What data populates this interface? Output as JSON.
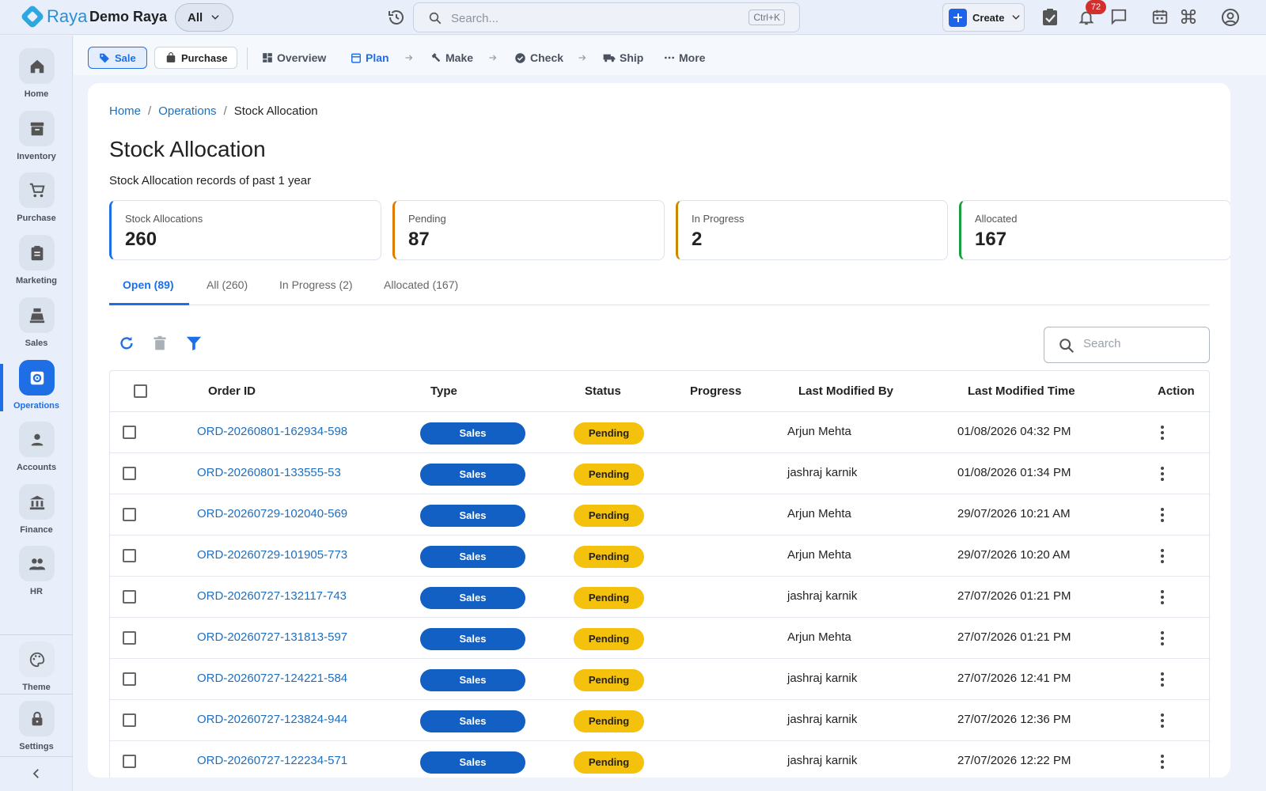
{
  "topbar": {
    "brand": "Raya",
    "company": "Demo Raya",
    "scope": "All",
    "search_placeholder": "Search...",
    "search_shortcut": "Ctrl+K",
    "create_label": "Create",
    "notification_count": "72",
    "icons": [
      "history-icon",
      "search-icon",
      "tasks-icon",
      "bell-icon",
      "chat-icon",
      "calendar-icon",
      "command-icon",
      "account-icon"
    ]
  },
  "sidebar": {
    "items": [
      {
        "label": "Home",
        "icon": "home-icon"
      },
      {
        "label": "Inventory",
        "icon": "archive-icon"
      },
      {
        "label": "Purchase",
        "icon": "cart-icon"
      },
      {
        "label": "Marketing",
        "icon": "clipboard-icon"
      },
      {
        "label": "Sales",
        "icon": "register-icon"
      },
      {
        "label": "Operations",
        "icon": "gear-box-icon",
        "active": true
      },
      {
        "label": "Accounts",
        "icon": "person-icon"
      },
      {
        "label": "Finance",
        "icon": "bank-icon"
      },
      {
        "label": "HR",
        "icon": "people-icon"
      }
    ],
    "theme_label": "Theme",
    "settings_label": "Settings"
  },
  "subnav": {
    "chips": [
      {
        "label": "Sale",
        "active": true
      },
      {
        "label": "Purchase",
        "active": false
      }
    ],
    "items": [
      {
        "label": "Overview",
        "icon": "dashboard-icon"
      },
      {
        "label": "Plan",
        "icon": "calendar-icon",
        "active": true
      },
      {
        "label": "Make",
        "icon": "hammer-icon"
      },
      {
        "label": "Check",
        "icon": "verified-icon"
      },
      {
        "label": "Ship",
        "icon": "truck-icon"
      },
      {
        "label": "More",
        "icon": "dots-icon"
      }
    ]
  },
  "breadcrumb": {
    "home": "Home",
    "section": "Operations",
    "current": "Stock Allocation"
  },
  "page": {
    "title": "Stock Allocation",
    "subtitle": "Stock Allocation records of past 1 year"
  },
  "kpis": [
    {
      "label": "Stock Allocations",
      "value": "260",
      "color": "#1e6fe6"
    },
    {
      "label": "Pending",
      "value": "87",
      "color": "#e07b00"
    },
    {
      "label": "In Progress",
      "value": "2",
      "color": "#c98a00"
    },
    {
      "label": "Allocated",
      "value": "167",
      "color": "#1a9e3f"
    }
  ],
  "tabs": [
    {
      "label": "Open (89)",
      "active": true
    },
    {
      "label": "All (260)"
    },
    {
      "label": "In Progress (2)"
    },
    {
      "label": "Allocated (167)"
    }
  ],
  "grid_search_placeholder": "Search",
  "table": {
    "columns": [
      "Order ID",
      "Type",
      "Status",
      "Progress",
      "Last Modified By",
      "Last Modified Time",
      "Action"
    ],
    "rows": [
      {
        "id": "ORD-20260801-162934-598",
        "type": "Sales",
        "status": "Pending",
        "progress": "",
        "by": "Arjun Mehta",
        "time": "01/08/2026 04:32 PM"
      },
      {
        "id": "ORD-20260801-133555-53",
        "type": "Sales",
        "status": "Pending",
        "progress": "",
        "by": "jashraj karnik",
        "time": "01/08/2026 01:34 PM"
      },
      {
        "id": "ORD-20260729-102040-569",
        "type": "Sales",
        "status": "Pending",
        "progress": "",
        "by": "Arjun Mehta",
        "time": "29/07/2026 10:21 AM"
      },
      {
        "id": "ORD-20260729-101905-773",
        "type": "Sales",
        "status": "Pending",
        "progress": "",
        "by": "Arjun Mehta",
        "time": "29/07/2026 10:20 AM"
      },
      {
        "id": "ORD-20260727-132117-743",
        "type": "Sales",
        "status": "Pending",
        "progress": "",
        "by": "jashraj karnik",
        "time": "27/07/2026 01:21 PM"
      },
      {
        "id": "ORD-20260727-131813-597",
        "type": "Sales",
        "status": "Pending",
        "progress": "",
        "by": "Arjun Mehta",
        "time": "27/07/2026 01:21 PM"
      },
      {
        "id": "ORD-20260727-124221-584",
        "type": "Sales",
        "status": "Pending",
        "progress": "",
        "by": "jashraj karnik",
        "time": "27/07/2026 12:41 PM"
      },
      {
        "id": "ORD-20260727-123824-944",
        "type": "Sales",
        "status": "Pending",
        "progress": "",
        "by": "jashraj karnik",
        "time": "27/07/2026 12:36 PM"
      },
      {
        "id": "ORD-20260727-122234-571",
        "type": "Sales",
        "status": "Pending",
        "progress": "",
        "by": "jashraj karnik",
        "time": "27/07/2026 12:22 PM"
      }
    ]
  }
}
